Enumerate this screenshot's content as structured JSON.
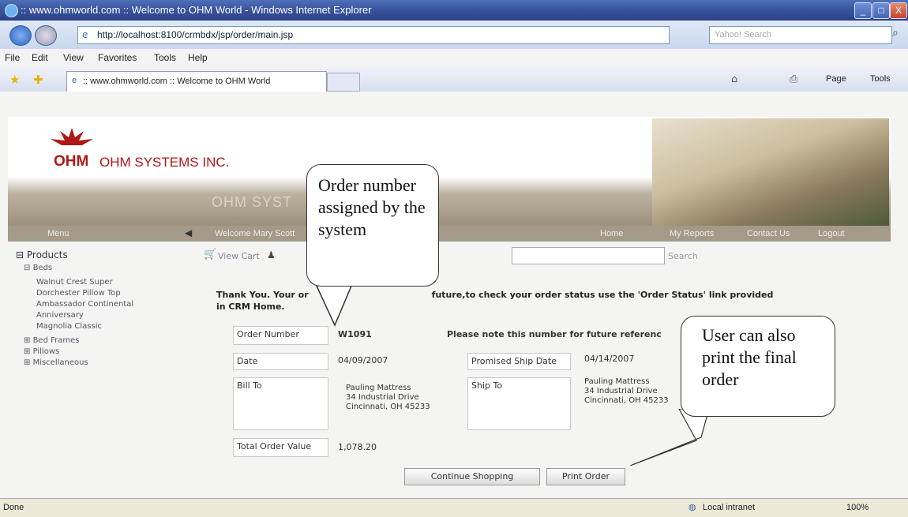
{
  "window": {
    "title": ":: www.ohmworld.com :: Welcome to OHM World - Windows Internet Explorer",
    "minimize": "_",
    "maximize": "□",
    "close": "X"
  },
  "addressbar": {
    "url": "http://localhost:8100/crmbdx/jsp/order/main.jsp",
    "search_placeholder": "Yahoo! Search"
  },
  "menubar": [
    "File",
    "Edit",
    "View",
    "Favorites",
    "Tools",
    "Help"
  ],
  "tab": {
    "title": ":: www.ohmworld.com :: Welcome to OHM World"
  },
  "command_bar": {
    "page": "Page",
    "tools": "Tools"
  },
  "site": {
    "logo_text": "OHM",
    "company": "OHM SYSTEMS INC.",
    "banner_text": "OHM SYST"
  },
  "navstrip": {
    "menu": "Menu",
    "welcome": "Welcome Mary Scott",
    "home": "Home",
    "my_reports": "My Reports",
    "contact_us": "Contact Us",
    "logout": "Logout"
  },
  "toolbar": {
    "view_cart": "View Cart",
    "search_label": "Search"
  },
  "sidebar": {
    "products": "Products",
    "beds": "Beds",
    "bed_items": [
      "Walnut Crest Super",
      "Dorchester Pillow Top",
      "Ambassador Continental",
      "Anniversary",
      "Magnolia Classic"
    ],
    "other_categories": [
      "Bed Frames",
      "Pillows",
      "Miscellaneous"
    ]
  },
  "order": {
    "thanks_line1": "Thank You. Your or",
    "thanks_line1_end": "future,to check your order status use the 'Order Status' link provided",
    "thanks_line2": "in CRM Home.",
    "order_number_label": "Order Number",
    "order_number": "W1091",
    "note": "Please note this number for future referenc",
    "date_label": "Date",
    "date": "04/09/2007",
    "ship_date_label": "Promised Ship Date",
    "ship_date": "04/14/2007",
    "bill_to_label": "Bill To",
    "bill_to": [
      "Pauling Mattress",
      "34 Industrial Drive",
      "Cincinnati, OH 45233"
    ],
    "ship_to_label": "Ship To",
    "ship_to": [
      "Pauling Mattress",
      "34 Industrial Drive",
      "Cincinnati, OH 45233"
    ],
    "total_label": "Total Order Value",
    "total": "1,078.20",
    "continue_button": "Continue Shopping",
    "print_button": "Print Order"
  },
  "callouts": {
    "order_number": "Order number assigned by the system",
    "print": "User can also print the final order"
  },
  "statusbar": {
    "status": "Done",
    "zone": "Local intranet",
    "zoom": "100%"
  },
  "colors": {
    "titlebar": "#3a55a0",
    "brand_red": "#b01818",
    "nav_strip": "#a39a8a"
  }
}
